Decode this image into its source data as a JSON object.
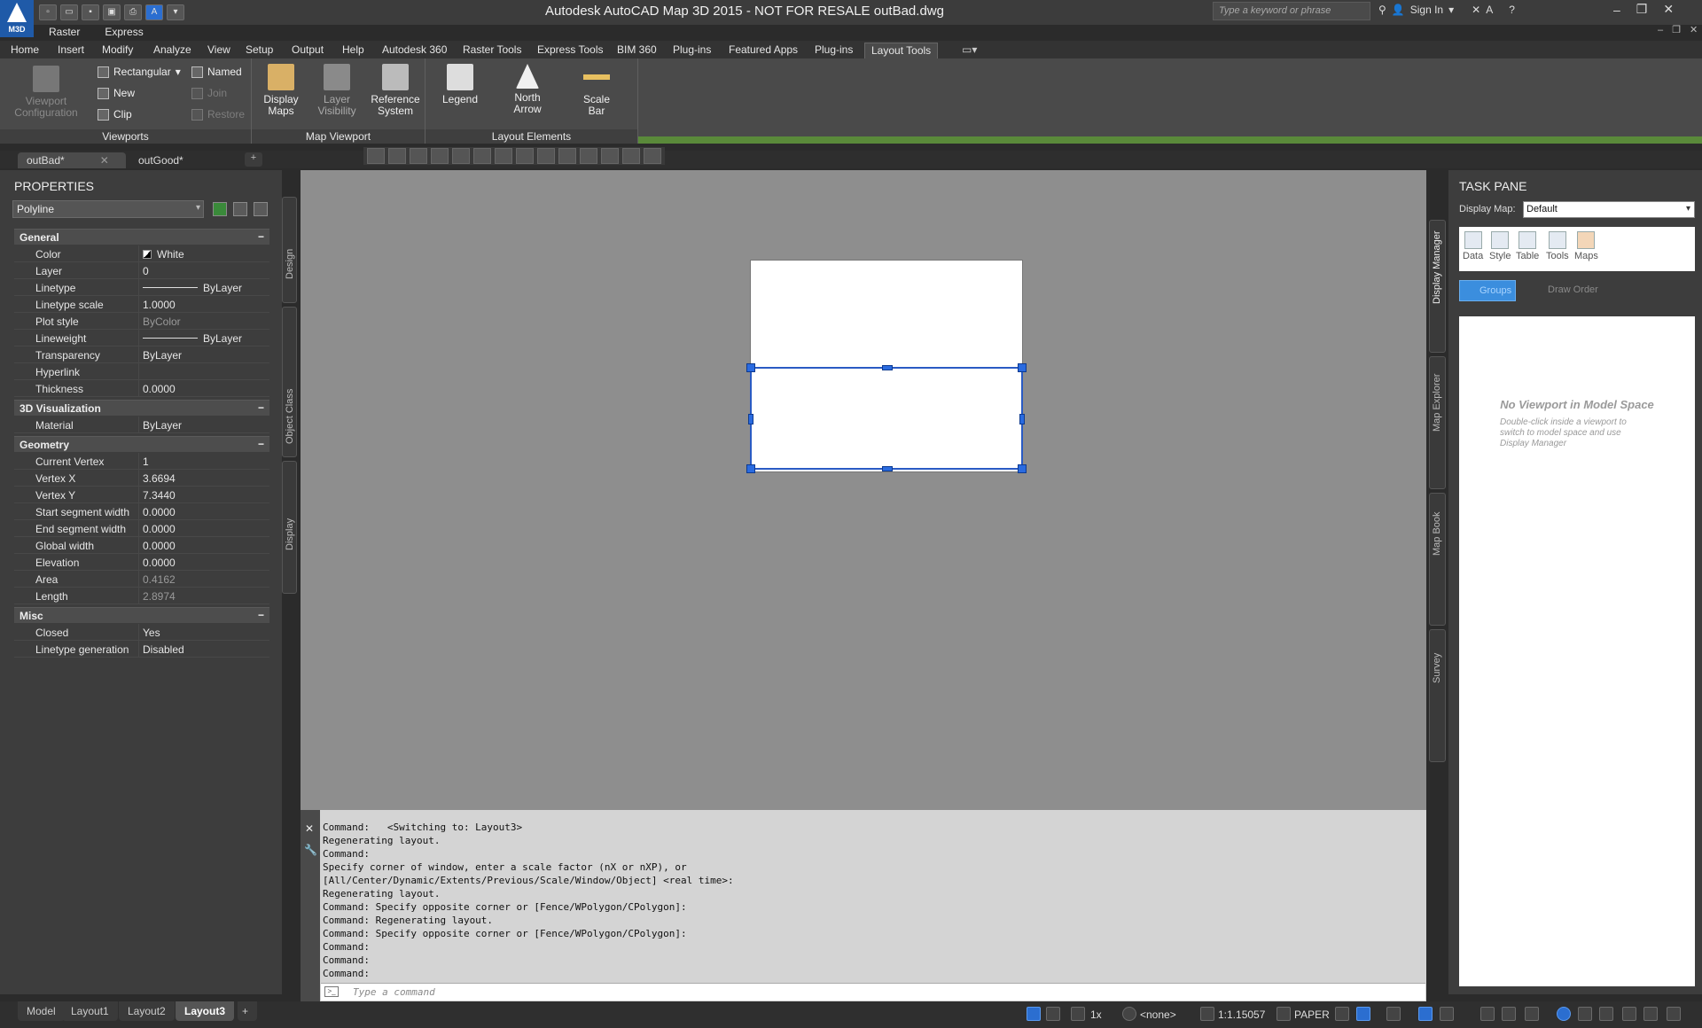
{
  "app": {
    "logo_text": "M3D",
    "title": "Autodesk AutoCAD Map 3D 2015 - NOT FOR RESALE    outBad.dwg",
    "search_placeholder": "Type a keyword or phrase",
    "sign_in": "Sign In"
  },
  "menubar": [
    "Raster",
    "Express"
  ],
  "ribbon_tabs": [
    {
      "label": "Home",
      "active": false
    },
    {
      "label": "Insert",
      "active": false
    },
    {
      "label": "Modify",
      "active": false
    },
    {
      "label": "Analyze",
      "active": false
    },
    {
      "label": "View",
      "active": false
    },
    {
      "label": "Setup",
      "active": false
    },
    {
      "label": "Output",
      "active": false
    },
    {
      "label": "Help",
      "active": false
    },
    {
      "label": "Autodesk 360",
      "active": false
    },
    {
      "label": "Raster Tools",
      "active": false
    },
    {
      "label": "Express Tools",
      "active": false
    },
    {
      "label": "BIM 360",
      "active": false
    },
    {
      "label": "Plug-ins",
      "active": false
    },
    {
      "label": "Featured Apps",
      "active": false
    },
    {
      "label": "Plug-ins",
      "active": false
    },
    {
      "label": "Layout Tools",
      "active": true
    }
  ],
  "ribbon": {
    "viewports": {
      "title": "Viewports",
      "viewport_config": "Viewport Configuration",
      "rectangular": "Rectangular",
      "named": "Named",
      "new": "New",
      "join": "Join",
      "clip": "Clip",
      "restore": "Restore"
    },
    "map_viewport": {
      "title": "Map Viewport",
      "display_maps": "Display Maps",
      "layer_visibility": "Layer Visibility",
      "reference_system": "Reference System"
    },
    "layout_elements": {
      "title": "Layout Elements",
      "legend": "Legend",
      "north_arrow": "North Arrow",
      "scale_bar": "Scale Bar"
    }
  },
  "file_tabs": [
    {
      "label": "outBad*",
      "active": true
    },
    {
      "label": "outGood*",
      "active": false
    }
  ],
  "properties": {
    "title": "PROPERTIES",
    "object_type": "Polyline",
    "categories": [
      {
        "name": "General",
        "rows": [
          {
            "name": "Color",
            "value": "White",
            "ro": false
          },
          {
            "name": "Layer",
            "value": "0",
            "ro": false
          },
          {
            "name": "Linetype",
            "value": "ByLayer",
            "ro": false
          },
          {
            "name": "Linetype scale",
            "value": "1.0000",
            "ro": false
          },
          {
            "name": "Plot style",
            "value": "ByColor",
            "ro": true
          },
          {
            "name": "Lineweight",
            "value": "ByLayer",
            "ro": false
          },
          {
            "name": "Transparency",
            "value": "ByLayer",
            "ro": false
          },
          {
            "name": "Hyperlink",
            "value": "",
            "ro": false
          },
          {
            "name": "Thickness",
            "value": "0.0000",
            "ro": false
          }
        ]
      },
      {
        "name": "3D Visualization",
        "rows": [
          {
            "name": "Material",
            "value": "ByLayer",
            "ro": false
          }
        ]
      },
      {
        "name": "Geometry",
        "rows": [
          {
            "name": "Current Vertex",
            "value": "1",
            "ro": false
          },
          {
            "name": "Vertex X",
            "value": "3.6694",
            "ro": false
          },
          {
            "name": "Vertex Y",
            "value": "7.3440",
            "ro": false
          },
          {
            "name": "Start segment width",
            "value": "0.0000",
            "ro": false
          },
          {
            "name": "End segment width",
            "value": "0.0000",
            "ro": false
          },
          {
            "name": "Global width",
            "value": "0.0000",
            "ro": false
          },
          {
            "name": "Elevation",
            "value": "0.0000",
            "ro": false
          },
          {
            "name": "Area",
            "value": "0.4162",
            "ro": true
          },
          {
            "name": "Length",
            "value": "2.8974",
            "ro": true
          }
        ]
      },
      {
        "name": "Misc",
        "rows": [
          {
            "name": "Closed",
            "value": "Yes",
            "ro": false
          },
          {
            "name": "Linetype generation",
            "value": "Disabled",
            "ro": false
          }
        ]
      }
    ],
    "side_tabs": [
      "Design",
      "Object Class",
      "Display"
    ]
  },
  "command": {
    "history": [
      "Command:   <Switching to: Layout3>",
      "Regenerating layout.",
      "Command:",
      "Specify corner of window, enter a scale factor (nX or nXP), or",
      "[All/Center/Dynamic/Extents/Previous/Scale/Window/Object] <real time>:",
      "Regenerating layout.",
      "Command: Specify opposite corner or [Fence/WPolygon/CPolygon]:",
      "Command: Regenerating layout.",
      "Command: Specify opposite corner or [Fence/WPolygon/CPolygon]:",
      "Command:",
      "Command:",
      "Command:"
    ],
    "placeholder": "Type a command"
  },
  "taskpane": {
    "title": "TASK PANE",
    "display_map_label": "Display Map:",
    "display_map_value": "Default",
    "tools": [
      "Data",
      "Style",
      "Table",
      "Tools",
      "Maps"
    ],
    "groups_tab": "Groups",
    "draw_order_tab": "Draw Order",
    "empty_title": "No Viewport in Model Space",
    "empty_text": "Double-click inside a viewport to switch to model space and use Display Manager",
    "side_tabs": [
      "Display Manager",
      "Map Explorer",
      "Map Book",
      "Survey"
    ]
  },
  "layout_tabs": [
    {
      "label": "Model",
      "active": false
    },
    {
      "label": "Layout1",
      "active": false
    },
    {
      "label": "Layout2",
      "active": false
    },
    {
      "label": "Layout3",
      "active": true
    }
  ],
  "statusbar": {
    "zoom": "1x",
    "coord_system": "<none>",
    "scale": "1:1.15057",
    "space": "PAPER"
  }
}
